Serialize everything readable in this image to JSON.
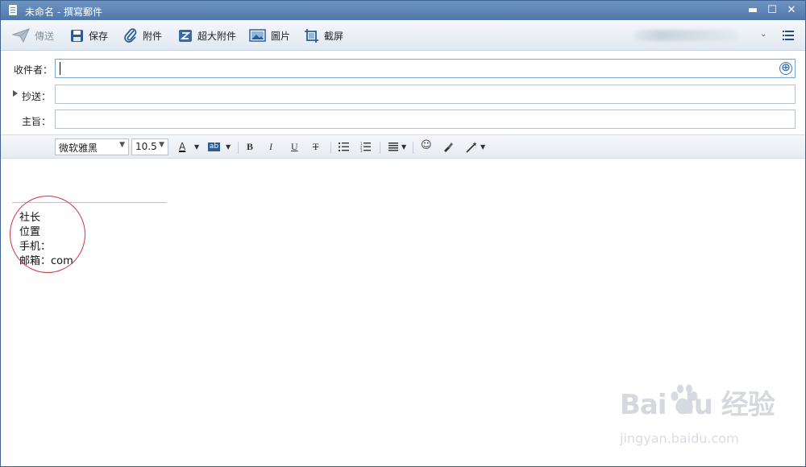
{
  "window": {
    "title": "未命名 - 撰寫郵件"
  },
  "window_controls": {
    "minimize": "▬",
    "maximize": "☐",
    "close": "✕"
  },
  "toolbar": {
    "send_label": "傳送",
    "save_label": "保存",
    "attach_label": "附件",
    "large_attach_label": "超大附件",
    "image_label": "圖片",
    "screenshot_label": "截屏"
  },
  "fields": {
    "to_label": "收件者：",
    "cc_label": "抄送：",
    "subject_label": "主旨：",
    "to_value": "",
    "cc_value": "",
    "subject_value": "",
    "add_icon": "⊕"
  },
  "format": {
    "font_family": "微软雅黑",
    "font_size": "10.5",
    "font_color": "A",
    "highlight": "ab",
    "bold": "B",
    "italic": "I",
    "underline": "U",
    "strikethrough": "T",
    "emoji": "☺"
  },
  "signature": {
    "lines": [
      "社长",
      "位置",
      "手机：",
      "邮箱：com"
    ]
  },
  "watermark": {
    "brand": "Bai du 经验",
    "url": "jingyan.baidu.com"
  },
  "colors": {
    "titlebar": "#5a82b5",
    "accent": "#3b78c2",
    "circle": "#d0343c"
  }
}
